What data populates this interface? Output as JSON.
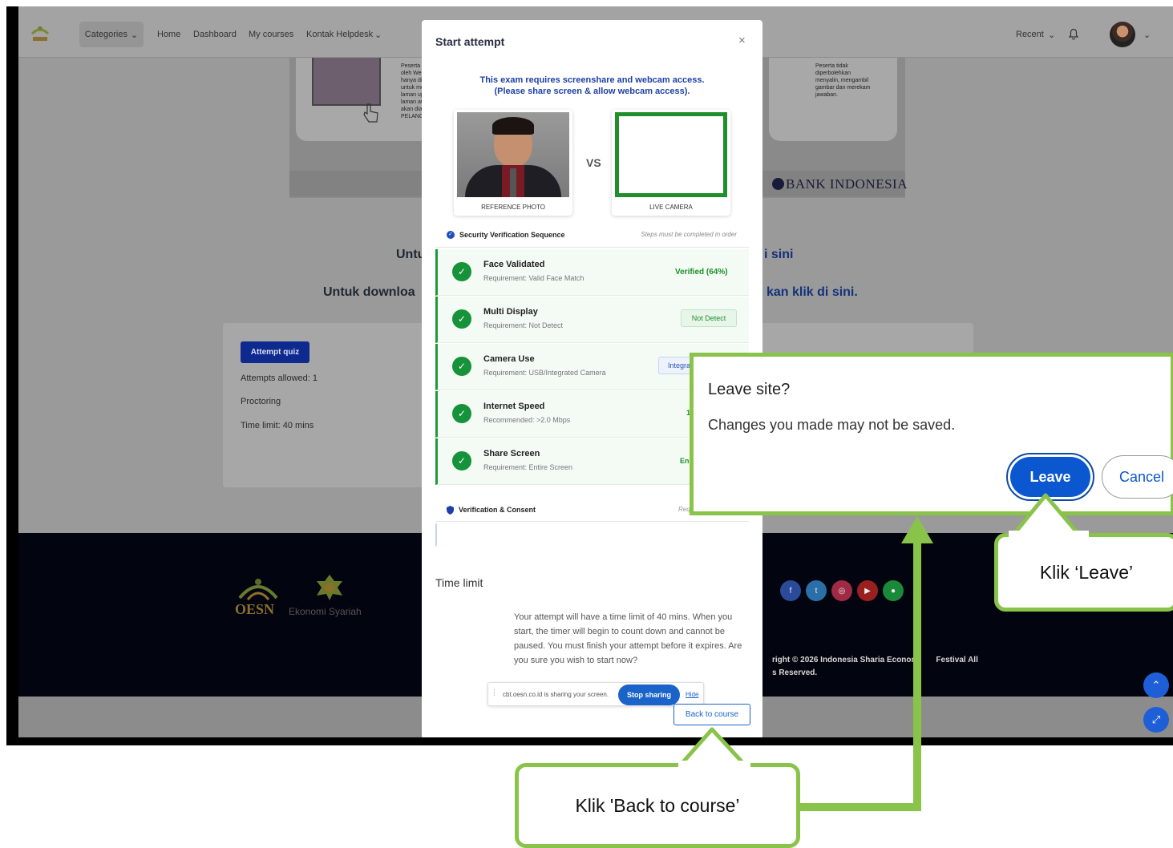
{
  "navbar": {
    "categories": "Categories",
    "links": [
      "Home",
      "Dashboard",
      "My courses",
      "Kontak Helpdesk"
    ],
    "recent": "Recent"
  },
  "background": {
    "bank": "BANK INDONESIA",
    "text_left_1": "Untu",
    "text_right_1": "i sini",
    "text_left_2": "Untuk downloa",
    "text_right_2": "kan klik di sini.",
    "small_left": [
      "Peserta d",
      "oleh Web",
      "hanya dip",
      "untuk me",
      "laman uji",
      "laman at",
      "akan dian",
      "PELANGG"
    ],
    "small_right": [
      "Peserta tidak",
      "diperbolehkan",
      "menyalin, mengambil",
      "gambar dan merekam",
      "jawaban."
    ]
  },
  "quiz": {
    "attempt_button": "Attempt quiz",
    "attempts_allowed": "Attempts allowed: 1",
    "proctoring": "Proctoring",
    "time_limit": "Time limit: 40 mins"
  },
  "footer": {
    "oesn": "OESN",
    "ekonomi": "Ekonomi Syariah",
    "copyright_1": "right © 2026 Indonesia Sharia Econom",
    "copyright_1b": "Festival All",
    "copyright_2": "s Reserved."
  },
  "modal": {
    "title": "Start attempt",
    "close": "×",
    "notice_1": "This exam requires screenshare and webcam access.",
    "notice_2": "(Please share screen & allow webcam access).",
    "reference_caption": "REFERENCE PHOTO",
    "vs": "VS",
    "live_caption": "LIVE CAMERA",
    "security_title": "Security Verification Sequence",
    "security_note": "Steps must be completed in order",
    "steps": [
      {
        "title": "Face Validated",
        "req": "Requirement: Valid Face Match",
        "badge": "Verified (64%)"
      },
      {
        "title": "Multi Display",
        "req": "Requirement: Not Detect",
        "badge": "Not Detect"
      },
      {
        "title": "Camera Use",
        "req": "Requirement: USB/Integrated Camera",
        "badge": "Integra"
      },
      {
        "title": "Internet Speed",
        "req": "Recommended: >2.0 Mbps",
        "badge": "1"
      },
      {
        "title": "Share Screen",
        "req": "Requirement: Entire Screen",
        "badge": "En"
      }
    ],
    "consent_title": "Verification & Consent",
    "consent_note": "Require",
    "time_limit_title": "Time limit",
    "time_limit_text": "Your attempt will have a time limit of 40 mins. When you start, the timer will begin to count down and cannot be paused. You must finish your attempt before it expires. Are you sure you wish to start now?",
    "share_text": "cbt.oesn.co.id is sharing your screen.",
    "stop_sharing": "Stop sharing",
    "hide": "Hide",
    "back_to_course": "Back to course"
  },
  "leave_dialog": {
    "title": "Leave site?",
    "message": "Changes you made may not be saved.",
    "leave": "Leave",
    "cancel": "Cancel"
  },
  "callouts": {
    "leave": "Klik ‘Leave’",
    "back": "Klik 'Back to course’"
  },
  "colors": {
    "callout_green": "#8ac34a",
    "primary_blue": "#0b57d0",
    "verified_green": "#1e8f2a"
  }
}
